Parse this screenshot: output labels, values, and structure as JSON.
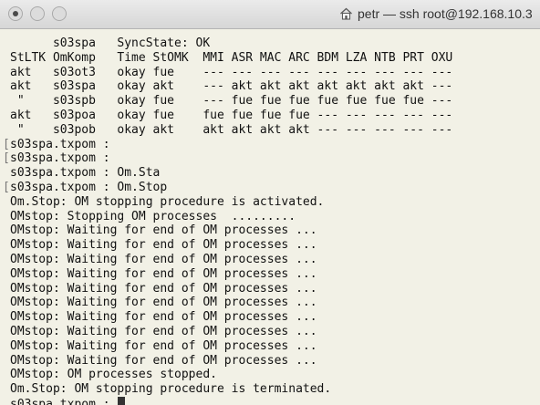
{
  "window": {
    "title": "petr — ssh root@192.168.10.3",
    "title_icon": "home-icon"
  },
  "terminal": {
    "lines": [
      "      s03spa   SyncState: OK",
      "StLTK OmKomp   Time StOMK  MMI ASR MAC ARC BDM LZA NTB PRT OXU",
      "akt   s03ot3   okay fue    --- --- --- --- --- --- --- --- ---",
      "akt   s03spa   okay akt    --- akt akt akt akt akt akt akt ---",
      " \"    s03spb   okay fue    --- fue fue fue fue fue fue fue ---",
      "akt   s03poa   okay fue    fue fue fue fue --- --- --- --- ---",
      " \"    s03pob   okay akt    akt akt akt akt --- --- --- --- ---",
      "s03spa.txpom :",
      "s03spa.txpom :",
      "s03spa.txpom : Om.Sta",
      "s03spa.txpom : Om.Stop",
      "Om.Stop: OM stopping procedure is activated.",
      "OMstop: Stopping OM processes  .........",
      "OMstop: Waiting for end of OM processes ...",
      "OMstop: Waiting for end of OM processes ...",
      "OMstop: Waiting for end of OM processes ...",
      "OMstop: Waiting for end of OM processes ...",
      "OMstop: Waiting for end of OM processes ...",
      "OMstop: Waiting for end of OM processes ...",
      "OMstop: Waiting for end of OM processes ...",
      "OMstop: Waiting for end of OM processes ...",
      "OMstop: Waiting for end of OM processes ...",
      "OMstop: Waiting for end of OM processes ...",
      "OMstop: OM processes stopped.",
      "Om.Stop: OM stopping procedure is terminated."
    ],
    "prompt": "s03spa.txpom : ",
    "mark_glyph": "["
  }
}
